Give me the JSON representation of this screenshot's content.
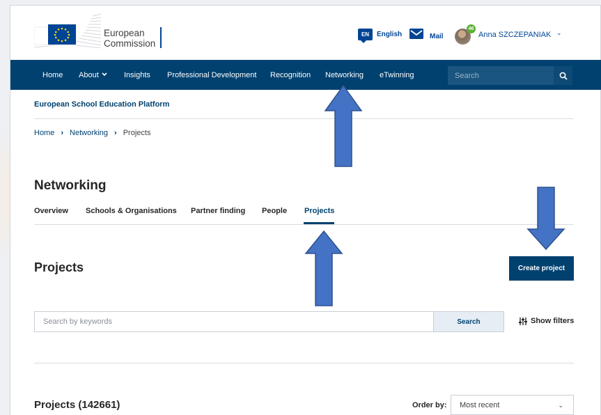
{
  "header": {
    "logo_line1": "European",
    "logo_line2": "Commission",
    "lang_code": "EN",
    "lang_label": "English",
    "mail_label": "Mail",
    "avatar_badge": "46",
    "user_name": "Anna SZCZEPANIAK"
  },
  "nav": {
    "items": [
      "Home",
      "About",
      "Insights",
      "Professional Development",
      "Recognition",
      "Networking",
      "eTwinning"
    ],
    "search_placeholder": "Search"
  },
  "platform_name": "European School Education Platform",
  "breadcrumb": [
    "Home",
    "Networking",
    "Projects"
  ],
  "section_title": "Networking",
  "subnav": [
    "Overview",
    "Schools & Organisations",
    "Partner finding",
    "People",
    "Projects"
  ],
  "projects_title": "Projects",
  "create_button": "Create project",
  "search": {
    "placeholder": "Search by keywords",
    "button": "Search"
  },
  "filters_label": "Show filters",
  "results_title": "Projects (142661)",
  "order": {
    "label": "Order by:",
    "value": "Most recent"
  },
  "colors": {
    "primary": "#004170",
    "accent": "#004494",
    "arrow_fill": "#4472c4",
    "arrow_stroke": "#2f528f"
  }
}
